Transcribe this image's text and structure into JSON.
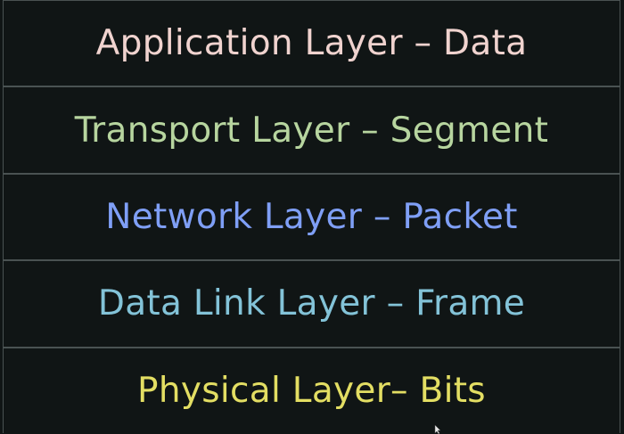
{
  "layers": [
    {
      "label": "Application Layer – Data",
      "color": "#f0d3cf"
    },
    {
      "label": "Transport Layer – Segment",
      "color": "#b7d59f"
    },
    {
      "label": "Network Layer – Packet",
      "color": "#7f9ff6"
    },
    {
      "label": "Data Link Layer – Frame",
      "color": "#83c3d8"
    },
    {
      "label": "Physical Layer– Bits",
      "color": "#e3de63"
    }
  ],
  "cursor": {
    "icon": "mouse-pointer-icon"
  }
}
